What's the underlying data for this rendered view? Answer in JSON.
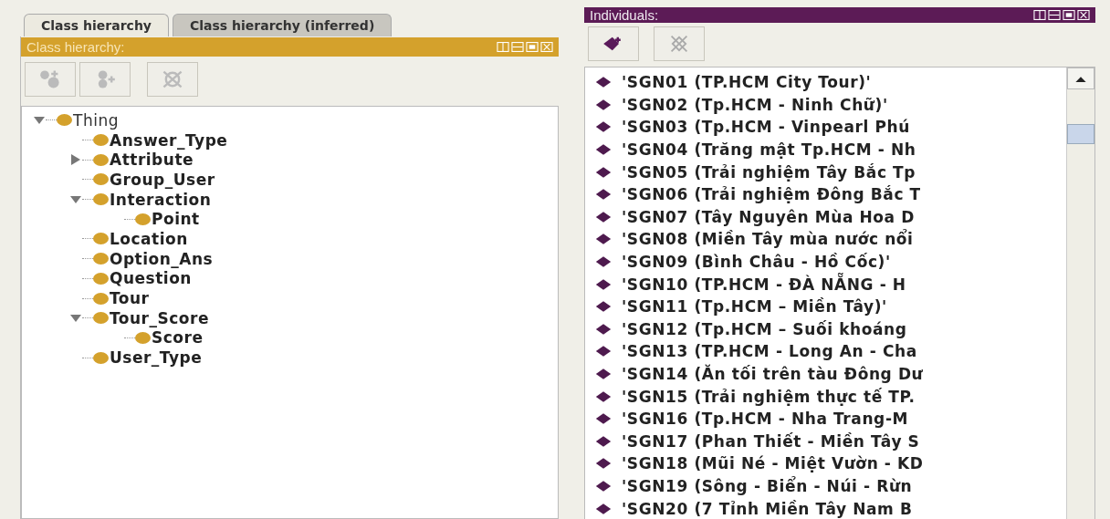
{
  "class_panel": {
    "tabs": [
      {
        "label": "Class hierarchy",
        "selected": true
      },
      {
        "label": "Class hierarchy (inferred)",
        "selected": false
      }
    ],
    "header": "Class hierarchy:",
    "toolbar": [
      {
        "kind": "add-subclass",
        "disabled": true
      },
      {
        "kind": "add-sibling",
        "disabled": true
      },
      {
        "kind": "delete",
        "disabled": true
      }
    ],
    "tree": [
      {
        "label": "Thing",
        "expanded": true,
        "children": [
          {
            "label": "Answer_Type"
          },
          {
            "label": "Attribute",
            "expanded": false
          },
          {
            "label": "Group_User"
          },
          {
            "label": "Interaction",
            "expanded": true,
            "children": [
              {
                "label": "Point"
              }
            ]
          },
          {
            "label": "Location"
          },
          {
            "label": "Option_Ans"
          },
          {
            "label": "Question"
          },
          {
            "label": "Tour"
          },
          {
            "label": "Tour_Score",
            "expanded": true,
            "children": [
              {
                "label": "Score"
              }
            ]
          },
          {
            "label": "User_Type"
          }
        ]
      }
    ]
  },
  "individuals_panel": {
    "header": "Individuals:",
    "toolbar": [
      {
        "kind": "add",
        "disabled": false
      },
      {
        "kind": "delete",
        "disabled": true
      }
    ],
    "items": [
      "'SGN01 (TP.HCM City Tour)'",
      "'SGN02 (Tp.HCM - Ninh Chữ)'",
      "'SGN03 (Tp.HCM - Vinpearl Phú",
      "'SGN04 (Trăng mật Tp.HCM - Nh",
      "'SGN05 (Trải nghiệm Tây Bắc Tp",
      "'SGN06 (Trải nghiệm Đông Bắc T",
      "'SGN07 (Tây Nguyên Mùa Hoa D",
      "'SGN08 (Miền Tây mùa nước nổi",
      "'SGN09 (Bình Châu - Hồ Cốc)'",
      "'SGN10 (TP.HCM - ĐÀ NẴNG - H",
      "'SGN11 (Tp.HCM – Miền Tây)'",
      "'SGN12 (Tp.HCM – Suối khoáng",
      "'SGN13 (TP.HCM - Long An - Cha",
      "'SGN14 (Ăn tối trên tàu Đông Dư",
      "'SGN15 (Trải nghiệm thực tế TP.",
      "'SGN16 (Tp.HCM - Nha Trang-M",
      "'SGN17 (Phan Thiết - Miền Tây S",
      "'SGN18 (Mũi Né - Miệt Vườn - KD",
      "'SGN19 (Sông - Biển - Núi - Rừn",
      "'SGN20 (7 Tỉnh Miền Tây Nam B"
    ]
  }
}
